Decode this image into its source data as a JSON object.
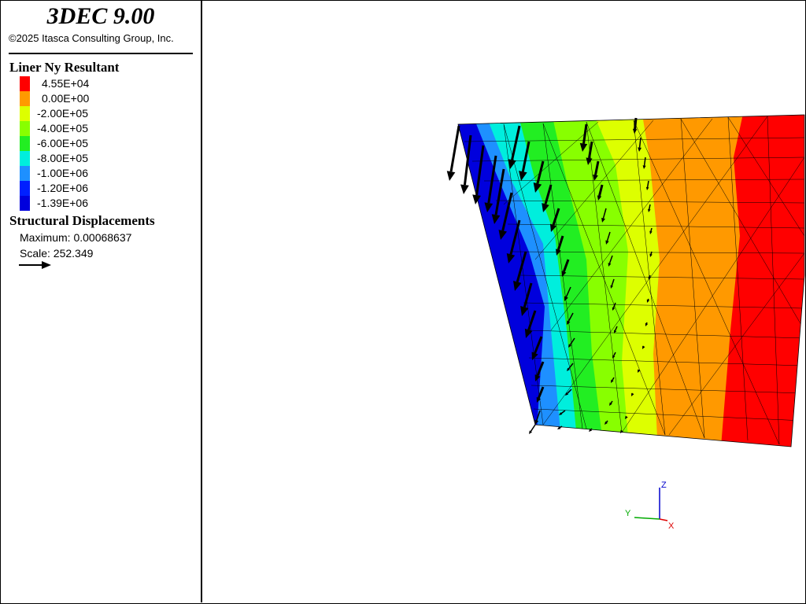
{
  "header": {
    "app_title": "3DEC 9.00",
    "copyright": "©2025 Itasca Consulting Group, Inc."
  },
  "contour_legend": {
    "title": "Liner Ny Resultant",
    "bands": [
      {
        "label": "4.55E+04",
        "color": "#ff0000"
      },
      {
        "label": "0.00E+00",
        "color": "#ff9900"
      },
      {
        "label": "-2.00E+05",
        "color": "#ddff00"
      },
      {
        "label": "-4.00E+05",
        "color": "#88ff00"
      },
      {
        "label": "-6.00E+05",
        "color": "#22ee22"
      },
      {
        "label": "-8.00E+05",
        "color": "#00eedd"
      },
      {
        "label": "-1.00E+06",
        "color": "#1e90ff"
      },
      {
        "label": "-1.20E+06",
        "color": "#0020ff"
      },
      {
        "label": "-1.39E+06",
        "color": "#0000dd"
      }
    ]
  },
  "displacement_legend": {
    "title": "Structural Displacements",
    "maximum": "Maximum: 0.00068637",
    "scale": "Scale: 252.349",
    "arrow_icon": "arrow-right-icon"
  },
  "axes": {
    "z": "Z",
    "y": "Y",
    "x": "X",
    "colors": {
      "z": "#0000cc",
      "y": "#00aa00",
      "x": "#dd0000"
    }
  }
}
